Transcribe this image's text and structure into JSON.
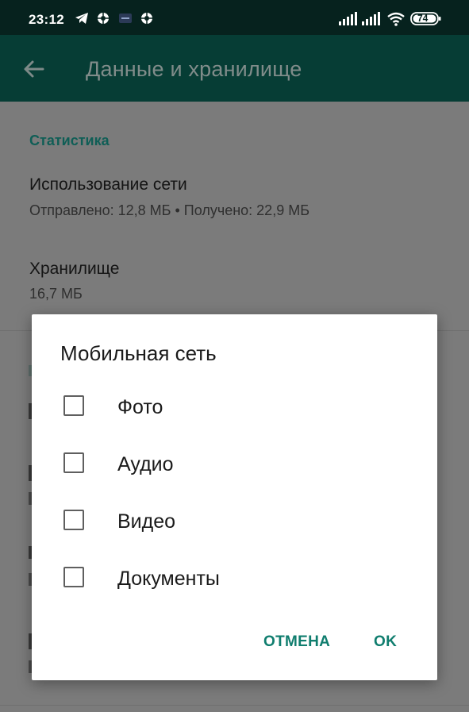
{
  "status_bar": {
    "time": "23:12",
    "battery": "74",
    "icons": [
      "telegram-icon",
      "notification-icon",
      "mail-icon",
      "notification-icon",
      "signal-icon",
      "signal-icon",
      "wifi-icon",
      "battery-icon"
    ]
  },
  "app_bar": {
    "title": "Данные и хранилище"
  },
  "background": {
    "section_title": "Статистика",
    "network_usage": {
      "title": "Использование сети",
      "subtitle": "Отправлено: 12,8 МБ • Получено: 22,9 МБ"
    },
    "storage": {
      "title": "Хранилище",
      "subtitle": "16,7 МБ"
    }
  },
  "dialog": {
    "title": "Мобильная сеть",
    "options": [
      {
        "label": "Фото",
        "checked": false
      },
      {
        "label": "Аудио",
        "checked": false
      },
      {
        "label": "Видео",
        "checked": false
      },
      {
        "label": "Документы",
        "checked": false
      }
    ],
    "cancel_label": "ОТМЕНА",
    "ok_label": "OK"
  },
  "colors": {
    "status_bar_bg": "#06221e",
    "app_bar_bg": "#063d35",
    "accent": "#0f7d6e",
    "scrim": "#7b7b7b"
  }
}
